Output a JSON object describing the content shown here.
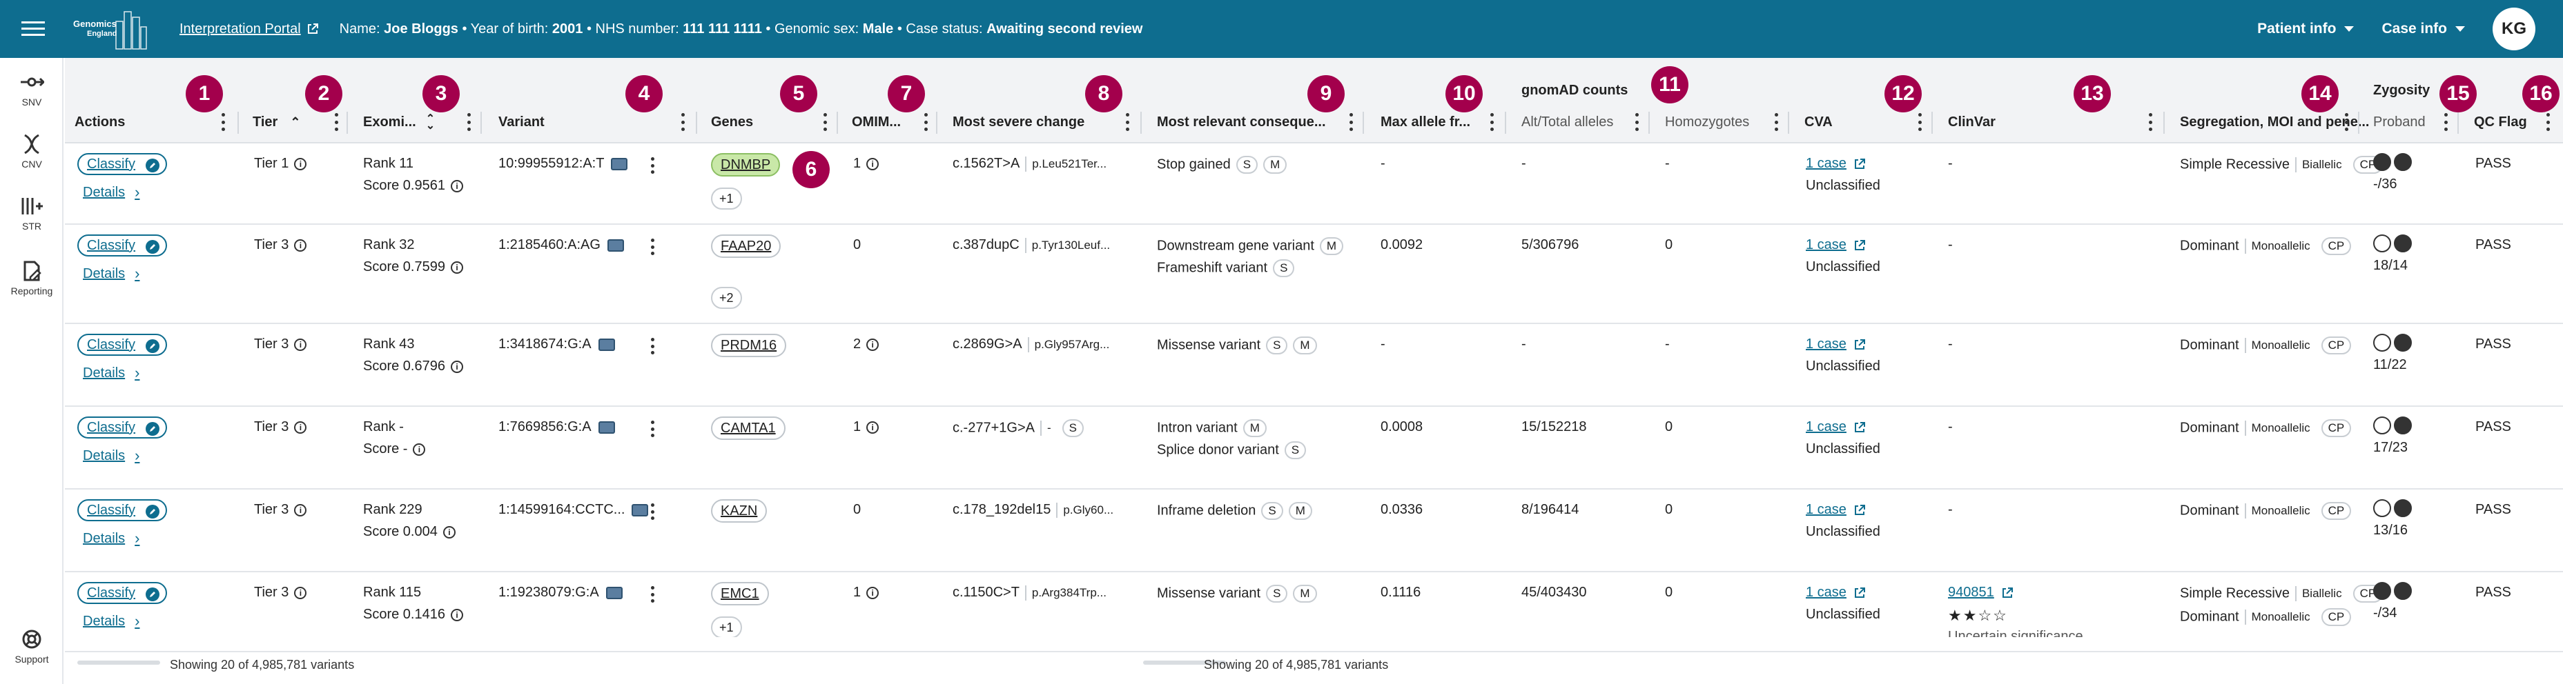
{
  "header": {
    "logo_line1": "Genomics",
    "logo_line2": "England",
    "portal_link": "Interpretation Portal",
    "patient_info_prefix_name": "Name: ",
    "patient_name": "Joe Bloggs",
    "sep1": " • Year of birth: ",
    "year_of_birth": "2001",
    "sep2": " • NHS number: ",
    "nhs_number": "111 111 1111",
    "sep3": " • Genomic sex: ",
    "genomic_sex": "Male",
    "sep4": " • Case status: ",
    "case_status": "Awaiting second review",
    "patient_info_menu": "Patient info",
    "case_info_menu": "Case info",
    "avatar_initials": "KG"
  },
  "rail": {
    "snv": "SNV",
    "cnv": "CNV",
    "str": "STR",
    "reporting": "Reporting",
    "support": "Support"
  },
  "columns": {
    "actions": "Actions",
    "tier": "Tier",
    "exomiser": "Exomi...",
    "variant": "Variant",
    "genes": "Genes",
    "omim": "OMIM...",
    "most_severe": "Most severe change",
    "most_relevant": "Most relevant conseque...",
    "max_allele": "Max allele fr...",
    "gnomad_group": "gnomAD counts",
    "alt_total": "Alt/Total alleles",
    "homozygotes": "Homozygotes",
    "cva": "CVA",
    "clinvar": "ClinVar",
    "segregation": "Segregation, MOI and pene...",
    "zygosity_group": "Zygosity",
    "proband": "Proband",
    "qc_flag": "QC Flag"
  },
  "badges": [
    "1",
    "2",
    "3",
    "4",
    "5",
    "6",
    "7",
    "8",
    "9",
    "10",
    "11",
    "12",
    "13",
    "14",
    "15",
    "16"
  ],
  "row_common": {
    "classify": "Classify",
    "details": "Details",
    "unclassified": "Unclassified"
  },
  "rows": [
    {
      "tier": "Tier 1",
      "rank": "Rank 11",
      "score": "Score 0.9561",
      "variant": "10:99955912:A:T",
      "gene": "DNMBP",
      "gene_hl": true,
      "plus": "+1",
      "omim": "1",
      "cdna": "c.1562T>A",
      "prot": "p.Leu521Ter...",
      "conseq1": "Stop gained",
      "c1p1": "S",
      "c1p2": "M",
      "conseq2": "",
      "c2p1": "",
      "c2p2": "",
      "maxaf": "-",
      "alt": "-",
      "hom": "-",
      "cva": "1 case",
      "clinvar": "-",
      "clinvar_stars": "",
      "clinvar_sig": "",
      "seg1": "Simple Recessive",
      "moi1": "Biallelic",
      "seg2": "",
      "moi2": "",
      "zyg": [
        "f",
        "f"
      ],
      "zygtxt": "-/36",
      "qc": "PASS"
    },
    {
      "tier": "Tier 3",
      "rank": "Rank 32",
      "score": "Score 0.7599",
      "variant": "1:2185460:A:AG",
      "gene": "FAAP20",
      "gene_hl": false,
      "plus": "+2",
      "omim": "0",
      "cdna": "c.387dupC",
      "prot": "p.Tyr130Leuf...",
      "conseq1": "Downstream gene variant",
      "c1p1": "M",
      "c1p2": "",
      "conseq2": "Frameshift variant",
      "c2p1": "S",
      "c2p2": "",
      "maxaf": "0.0092",
      "alt": "5/306796",
      "hom": "0",
      "cva": "1 case",
      "clinvar": "-",
      "clinvar_stars": "",
      "clinvar_sig": "",
      "seg1": "Dominant",
      "moi1": "Monoallelic",
      "seg2": "",
      "moi2": "",
      "zyg": [
        "o",
        "f"
      ],
      "zygtxt": "18/14",
      "qc": "PASS"
    },
    {
      "tier": "Tier 3",
      "rank": "Rank 43",
      "score": "Score 0.6796",
      "variant": "1:3418674:G:A",
      "gene": "PRDM16",
      "gene_hl": false,
      "plus": "",
      "omim": "2",
      "cdna": "c.2869G>A",
      "prot": "p.Gly957Arg...",
      "conseq1": "Missense variant",
      "c1p1": "S",
      "c1p2": "M",
      "conseq2": "",
      "c2p1": "",
      "c2p2": "",
      "maxaf": "-",
      "alt": "-",
      "hom": "-",
      "cva": "1 case",
      "clinvar": "-",
      "clinvar_stars": "",
      "clinvar_sig": "",
      "seg1": "Dominant",
      "moi1": "Monoallelic",
      "seg2": "",
      "moi2": "",
      "zyg": [
        "o",
        "f"
      ],
      "zygtxt": "11/22",
      "qc": "PASS"
    },
    {
      "tier": "Tier 3",
      "rank": "Rank -",
      "score": "Score -",
      "variant": "1:7669856:G:A",
      "gene": "CAMTA1",
      "gene_hl": false,
      "plus": "",
      "omim": "1",
      "cdna": "c.-277+1G>A",
      "prot": "-",
      "conseq1": "Intron variant",
      "c1p1": "M",
      "c1p2": "",
      "conseq2": "Splice donor variant",
      "c2p1": "S",
      "c2p2": "",
      "maxaf": "0.0008",
      "alt": "15/152218",
      "hom": "0",
      "cva": "1 case",
      "clinvar": "-",
      "clinvar_stars": "",
      "clinvar_sig": "",
      "seg1": "Dominant",
      "moi1": "Monoallelic",
      "seg2": "",
      "moi2": "",
      "zyg": [
        "o",
        "f"
      ],
      "zygtxt": "17/23",
      "qc": "PASS"
    },
    {
      "tier": "Tier 3",
      "rank": "Rank 229",
      "score": "Score 0.004",
      "variant": "1:14599164:CCTC...",
      "gene": "KAZN",
      "gene_hl": false,
      "plus": "",
      "omim": "0",
      "cdna": "c.178_192del15",
      "prot": "p.Gly60...",
      "conseq1": "Inframe deletion",
      "c1p1": "S",
      "c1p2": "M",
      "conseq2": "",
      "c2p1": "",
      "c2p2": "",
      "maxaf": "0.0336",
      "alt": "8/196414",
      "hom": "0",
      "cva": "1 case",
      "clinvar": "-",
      "clinvar_stars": "",
      "clinvar_sig": "",
      "seg1": "Dominant",
      "moi1": "Monoallelic",
      "seg2": "",
      "moi2": "",
      "zyg": [
        "o",
        "f"
      ],
      "zygtxt": "13/16",
      "qc": "PASS"
    },
    {
      "tier": "Tier 3",
      "rank": "Rank 115",
      "score": "Score 0.1416",
      "variant": "1:19238079:G:A",
      "gene": "EMC1",
      "gene_hl": false,
      "plus": "+1",
      "omim": "1",
      "cdna": "c.1150C>T",
      "prot": "p.Arg384Trp...",
      "conseq1": "Missense variant",
      "c1p1": "S",
      "c1p2": "M",
      "conseq2": "",
      "c2p1": "",
      "c2p2": "",
      "maxaf": "0.1116",
      "alt": "45/403430",
      "hom": "0",
      "cva": "1 case",
      "clinvar": "940851",
      "clinvar_stars": "★★☆☆",
      "clinvar_sig": "Uncertain significance",
      "seg1": "Simple Recessive",
      "moi1": "Biallelic",
      "seg2": "Dominant",
      "moi2": "Monoallelic",
      "zyg": [
        "f",
        "f"
      ],
      "zygtxt": "-/34",
      "qc": "PASS"
    }
  ],
  "footer": {
    "showing_left": "Showing 20 of 4,985,781 variants",
    "showing_right": "Showing 20 of 4,985,781 variants"
  },
  "colors": {
    "brand": "#0e6d8f",
    "badge": "#a3004c",
    "gene_highlight": "#c9e8a8"
  }
}
